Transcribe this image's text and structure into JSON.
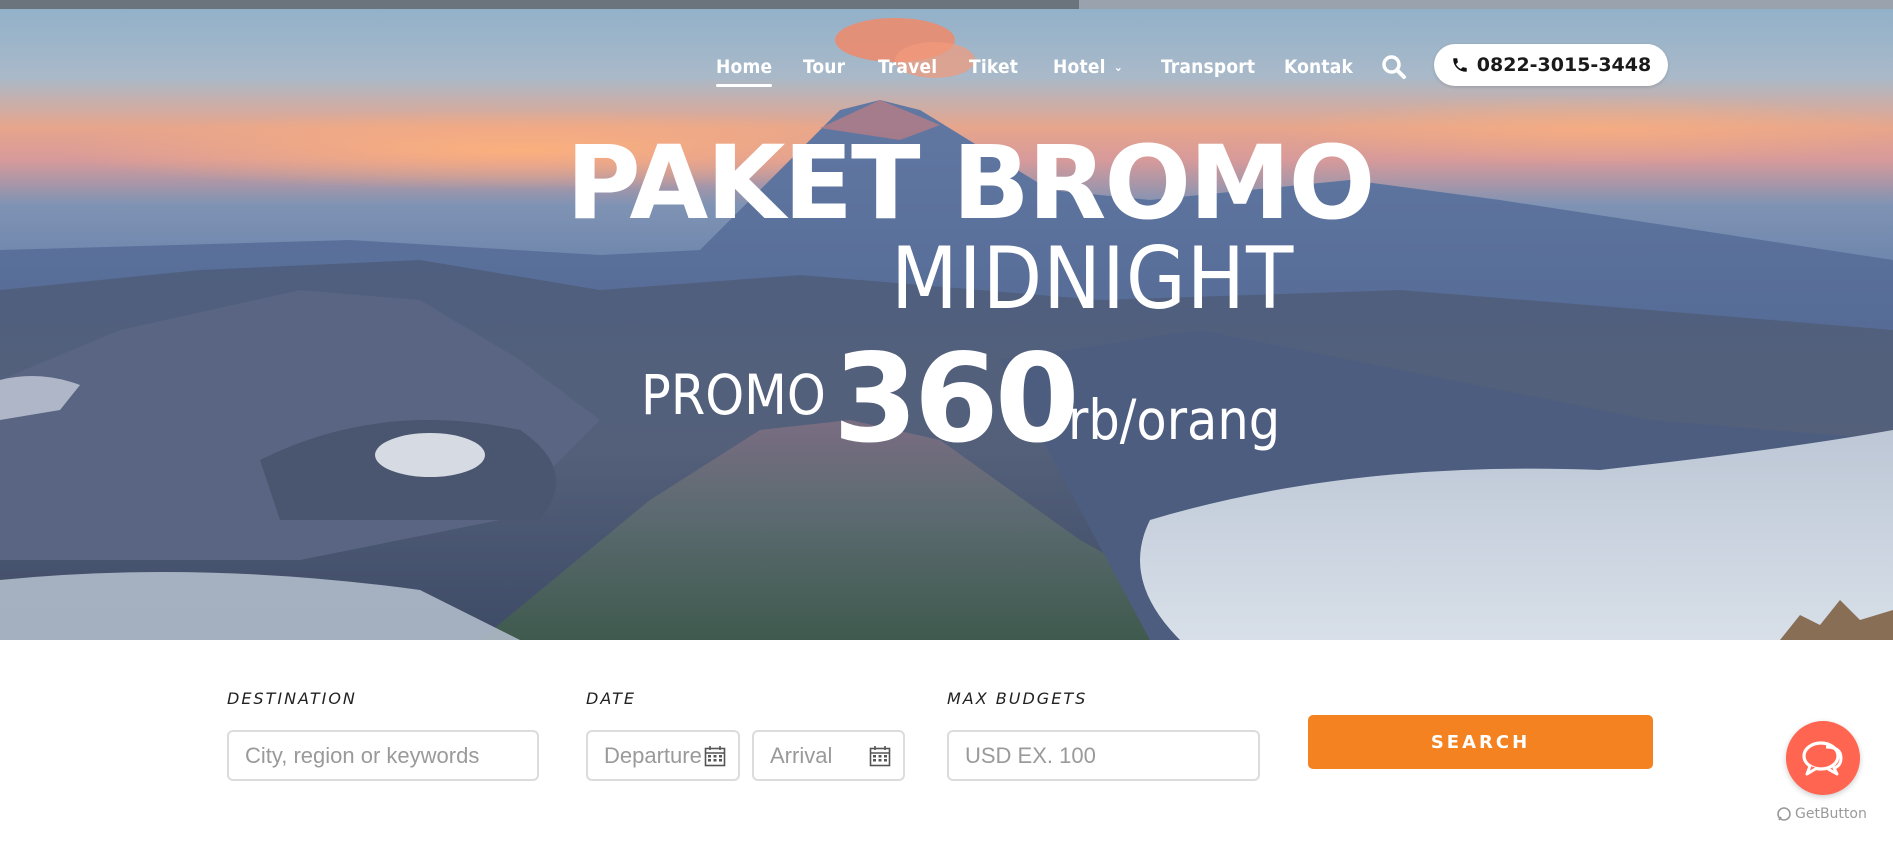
{
  "progress": {
    "fraction": 0.57
  },
  "nav": {
    "items": [
      {
        "label": "Home",
        "active": true
      },
      {
        "label": "Tour"
      },
      {
        "label": "Travel"
      },
      {
        "label": "Tiket"
      },
      {
        "label": "Hotel",
        "has_dropdown": true
      },
      {
        "label": "Transport"
      },
      {
        "label": "Kontak"
      }
    ],
    "search_icon": "search-icon",
    "phone": {
      "icon": "phone-icon",
      "number": "0822-3015-3448"
    }
  },
  "hero": {
    "line1": "PAKET BROMO",
    "line2": "MIDNIGHT",
    "promo_label": "PROMO",
    "price": "360",
    "price_unit": "rb/orang"
  },
  "search_form": {
    "destination": {
      "label": "DESTINATION",
      "placeholder": "City, region or keywords"
    },
    "date": {
      "label": "DATE",
      "departure_placeholder": "Departure",
      "arrival_placeholder": "Arrival",
      "icon": "calendar-icon"
    },
    "budget": {
      "label": "MAX BUDGETS",
      "placeholder": "USD EX. 100"
    },
    "search_label": "SEARCH"
  },
  "widget": {
    "chat_icon": "chat-bubbles-icon",
    "brand": "GetButton"
  },
  "colors": {
    "accent": "#f58220",
    "chat": "#ff6550"
  }
}
